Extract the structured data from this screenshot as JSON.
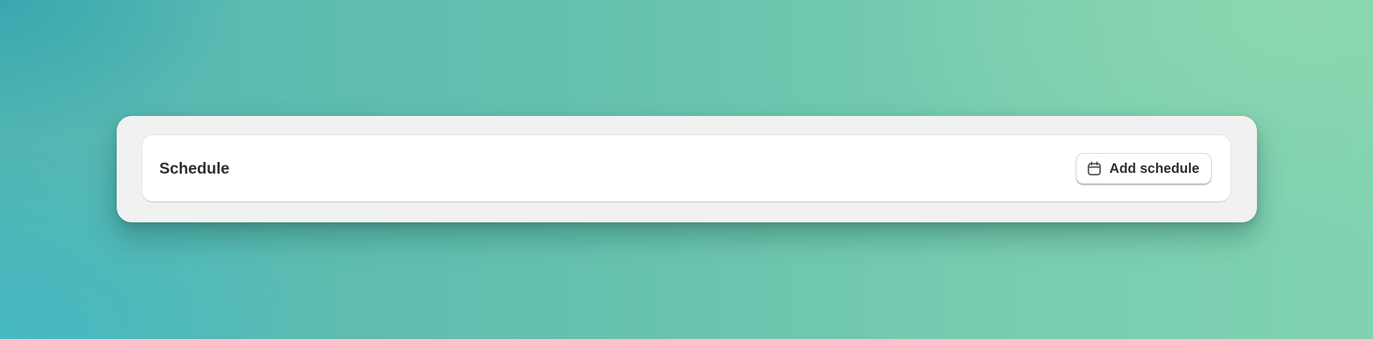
{
  "card": {
    "title": "Schedule"
  },
  "actions": {
    "add_schedule_label": "Add schedule",
    "add_schedule_icon": "calendar-icon"
  },
  "colors": {
    "text": "#303030",
    "panel": "#f1f1f1",
    "card": "#ffffff"
  }
}
